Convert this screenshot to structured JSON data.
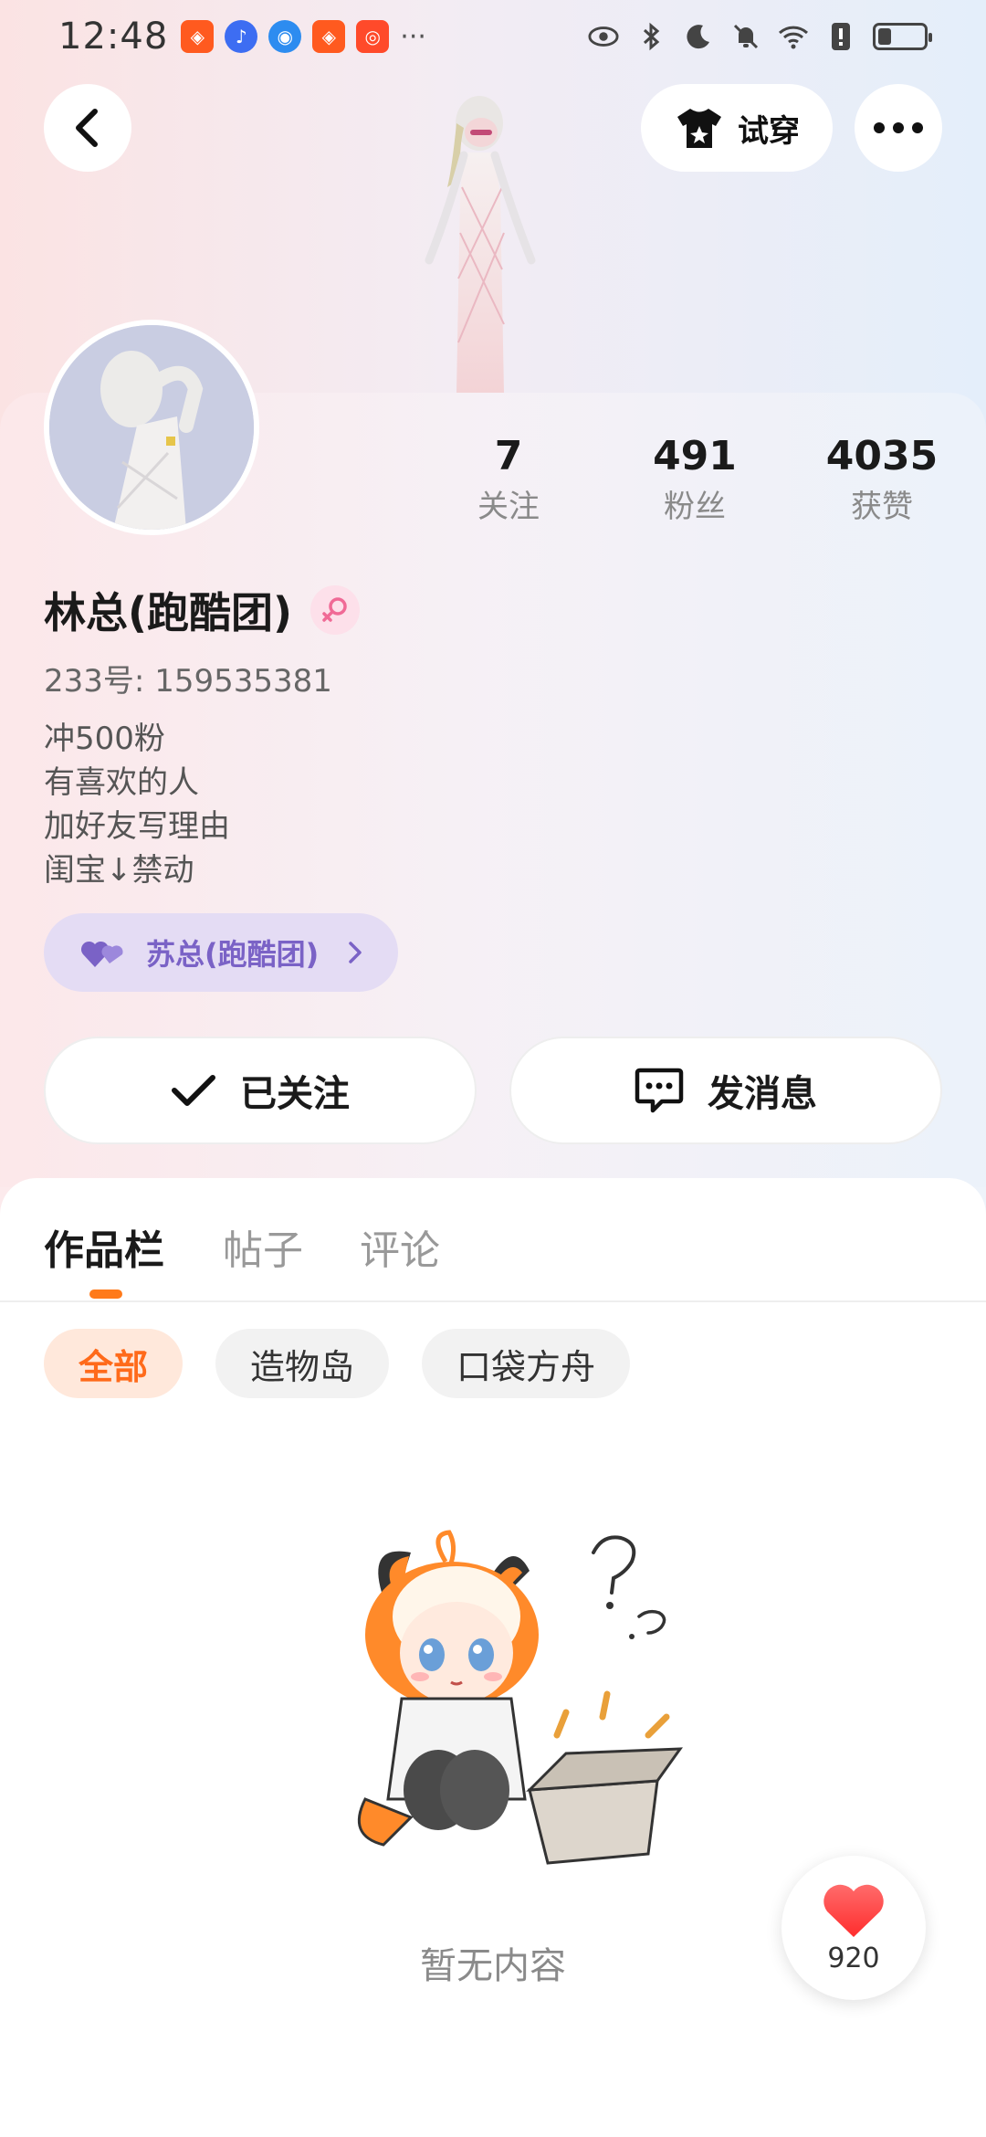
{
  "status_bar": {
    "time": "12:48",
    "more": "···",
    "icons": [
      "eye-icon",
      "bluetooth-icon",
      "moon-icon",
      "bell-off-icon",
      "wifi-icon",
      "alert-icon",
      "battery-icon"
    ]
  },
  "header": {
    "try_on_label": "试穿"
  },
  "profile": {
    "name": "林总(跑酷团)",
    "id_label": "233号",
    "id_separator": ":",
    "id_value": "159535381",
    "bio_lines": [
      "冲500粉",
      "有喜欢的人",
      "加好友写理由",
      "闺宝↓禁动"
    ],
    "couple_label": "苏总(跑酷团)"
  },
  "stats": [
    {
      "value": "7",
      "label": "关注"
    },
    {
      "value": "491",
      "label": "粉丝"
    },
    {
      "value": "4035",
      "label": "获赞"
    }
  ],
  "actions": {
    "followed_label": "已关注",
    "message_label": "发消息"
  },
  "tabs": [
    {
      "label": "作品栏",
      "active": true
    },
    {
      "label": "帖子",
      "active": false
    },
    {
      "label": "评论",
      "active": false
    }
  ],
  "filters": [
    {
      "label": "全部",
      "active": true
    },
    {
      "label": "造物岛",
      "active": false
    },
    {
      "label": "口袋方舟",
      "active": false
    }
  ],
  "empty_state": {
    "text": "暂无内容"
  },
  "like_button": {
    "count": "920"
  },
  "colors": {
    "accent": "#ff7a1a",
    "couple": "#7a62c6",
    "heart": "#ff3b3b"
  }
}
